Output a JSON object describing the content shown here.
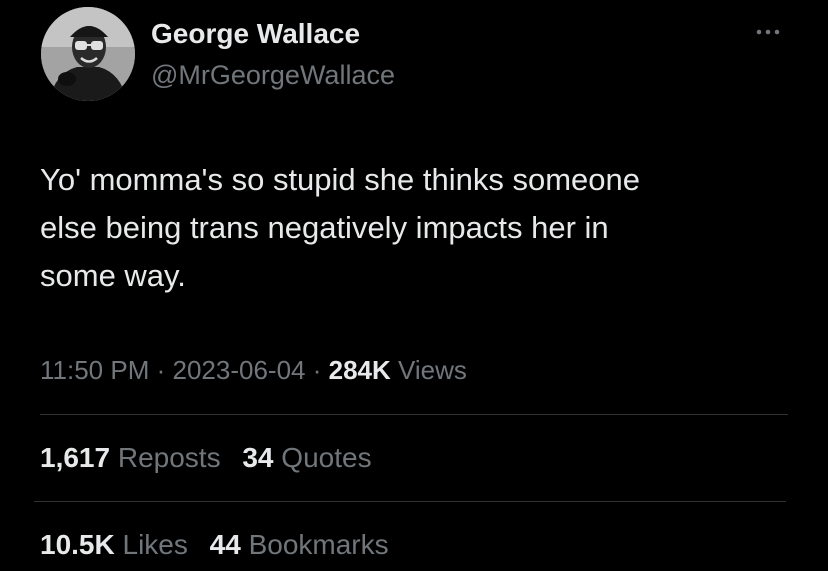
{
  "author": {
    "display_name": "George Wallace",
    "handle": "@MrGeorgeWallace",
    "avatar_icon": "profile-photo"
  },
  "menu_icon": "more-options-icon",
  "tweet": {
    "text": "Yo' momma's so stupid she thinks someone\nelse being trans negatively impacts her in\nsome way."
  },
  "meta": {
    "time": "11:50 PM",
    "separator": "·",
    "date": "2023-06-04",
    "views_count": "284K",
    "views_label": "Views"
  },
  "stats": {
    "reposts_count": "1,617",
    "reposts_label": "Reposts",
    "quotes_count": "34",
    "quotes_label": "Quotes",
    "likes_count": "10.5K",
    "likes_label": "Likes",
    "bookmarks_count": "44",
    "bookmarks_label": "Bookmarks"
  },
  "colors": {
    "background": "#000000",
    "primary_text": "#e7e9ea",
    "secondary_text": "#71767b",
    "divider": "#2f3336"
  }
}
